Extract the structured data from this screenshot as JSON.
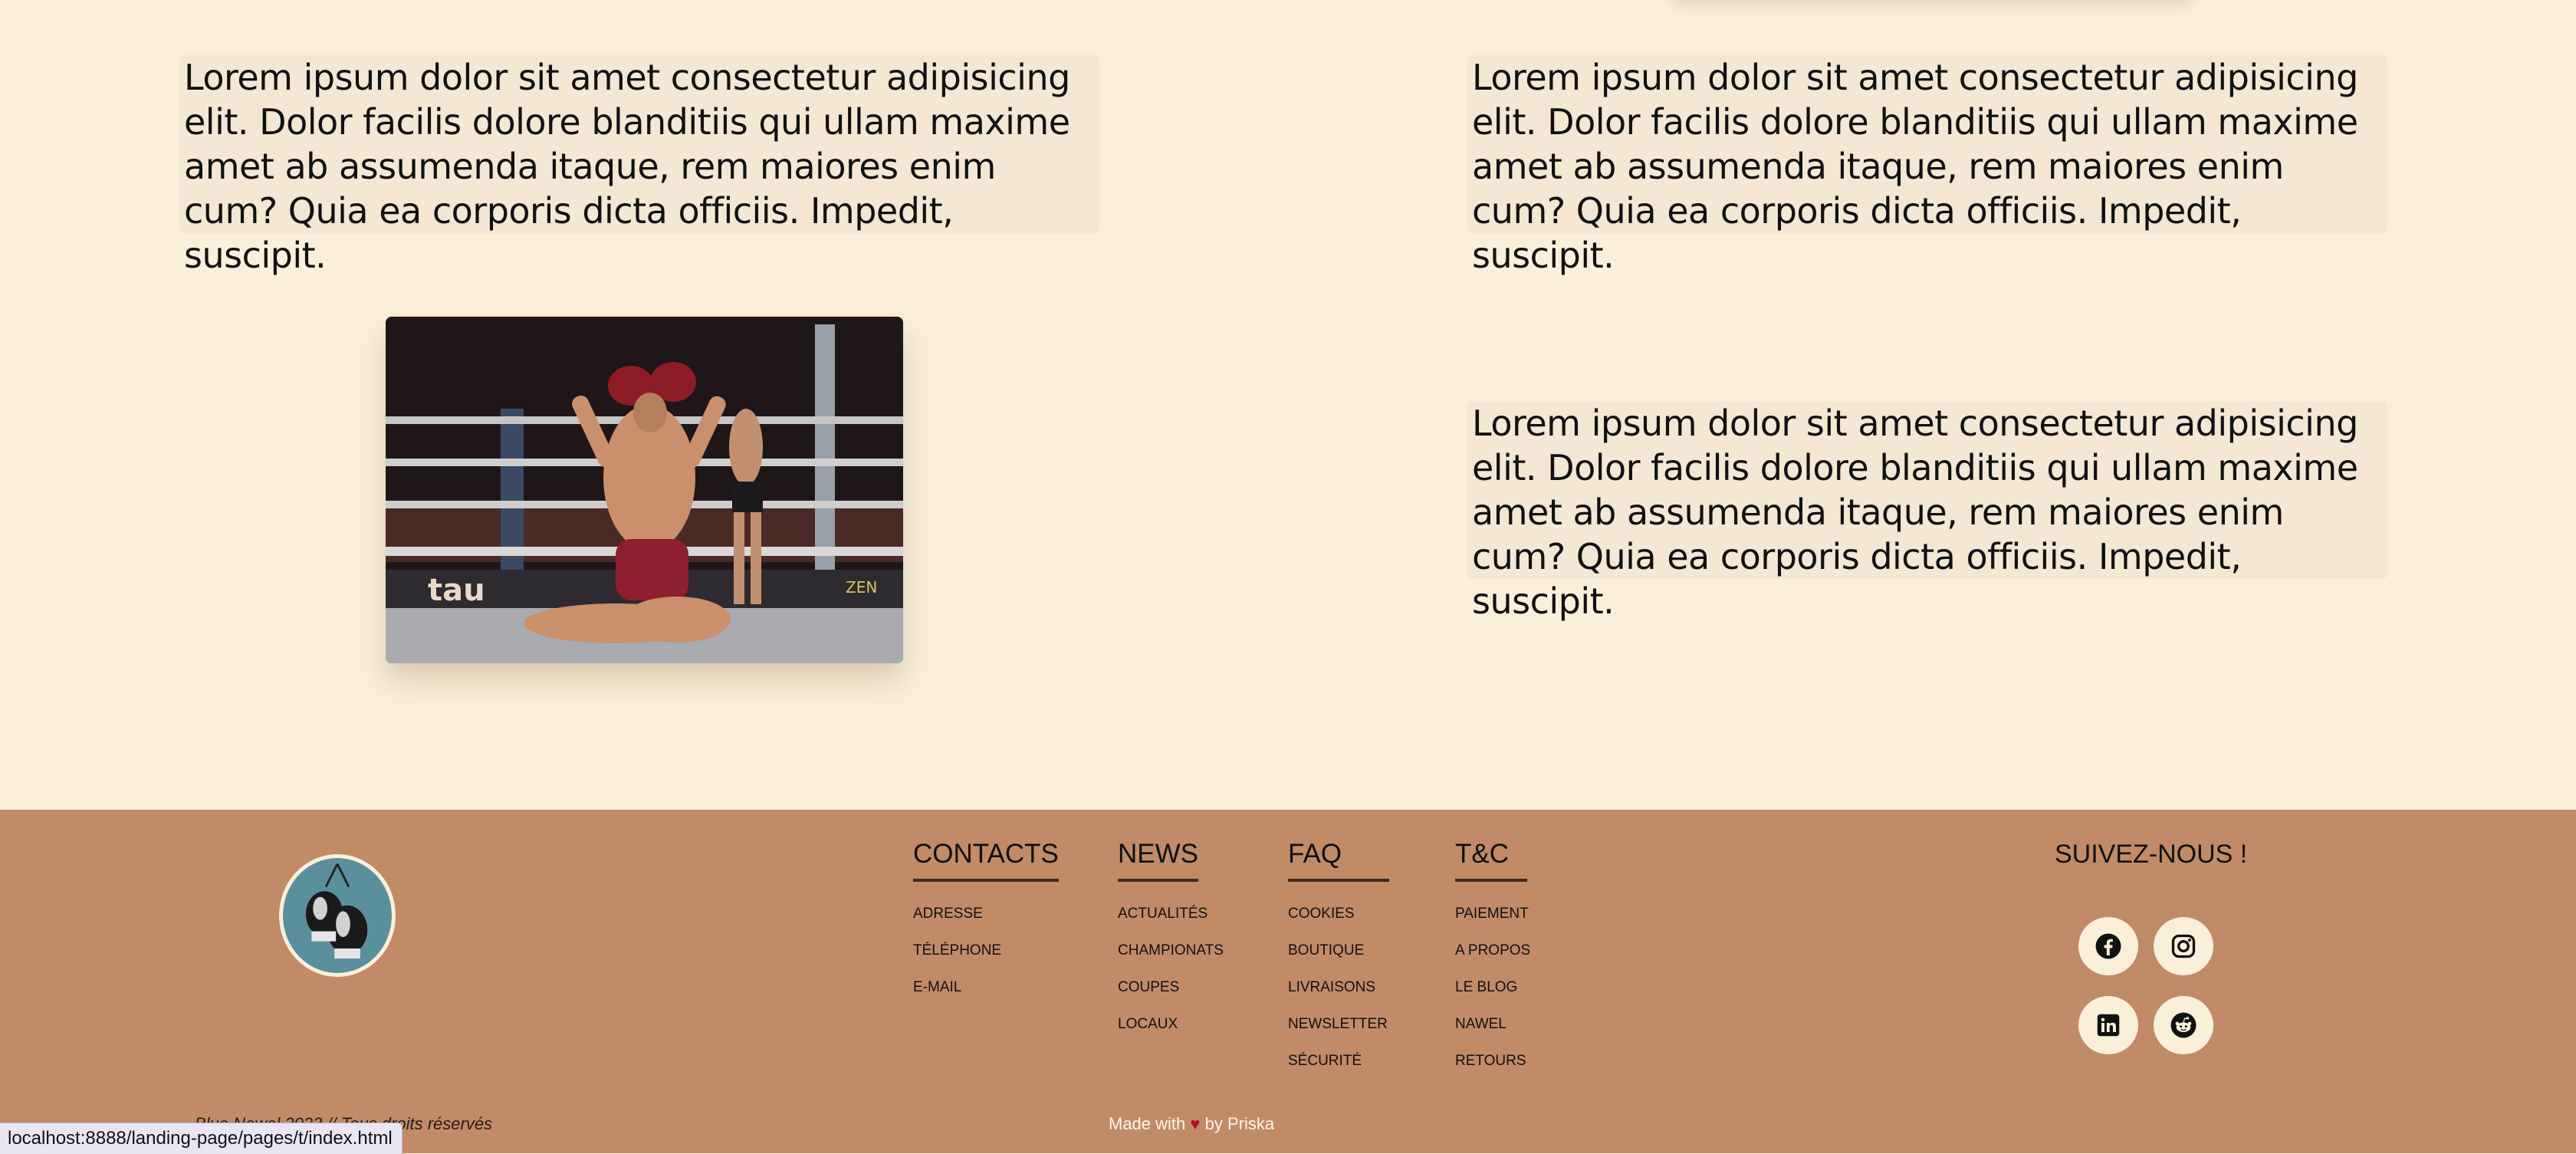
{
  "content": {
    "paragraph": "Lorem ipsum dolor sit amet consectetur adipisicing elit. Dolor facilis dolore blanditiis qui ullam maxime amet ab assumenda itaque, rem maiores enim cum? Quia ea corporis dicta officiis. Impedit, suscipit.",
    "photo_icon": "muay-thai-fighter-photo"
  },
  "footer": {
    "logo_icon": "boxing-gloves-logo-icon",
    "columns": [
      {
        "title": "CONTACTS",
        "items": [
          "ADRESSE",
          "TÉLÉPHONE",
          "E-MAIL"
        ]
      },
      {
        "title": "NEWS",
        "items": [
          "ACTUALITÉS",
          "CHAMPIONATS",
          "COUPES",
          "LOCAUX"
        ]
      },
      {
        "title": "FAQ",
        "items": [
          "COOKIES",
          "BOUTIQUE",
          "LIVRAISONS",
          "NEWSLETTER",
          "SÉCURITÉ"
        ]
      },
      {
        "title": "T&C",
        "items": [
          "PAIEMENT",
          "A PROPOS",
          "LE BLOG",
          "NAWEL",
          "RETOURS"
        ]
      }
    ],
    "follow_title": "SUIVEZ-NOUS !",
    "social_icons": [
      "facebook-icon",
      "instagram-icon",
      "linkedin-icon",
      "reddit-icon"
    ],
    "copyright": "Blue Nawel 2023 // Tous droits réservés",
    "made_with_prefix": "Made with",
    "heart": "♥",
    "made_with_suffix": "by Priska"
  },
  "status_bar": {
    "url": "localhost:8888/landing-page/pages/t/index.html"
  },
  "colors": {
    "page_bg": "#faefd9",
    "text_block_bg": "#f4e7d3",
    "footer_bg": "#c18b68",
    "logo_bg": "#5a909c",
    "heart": "#b3102a"
  }
}
